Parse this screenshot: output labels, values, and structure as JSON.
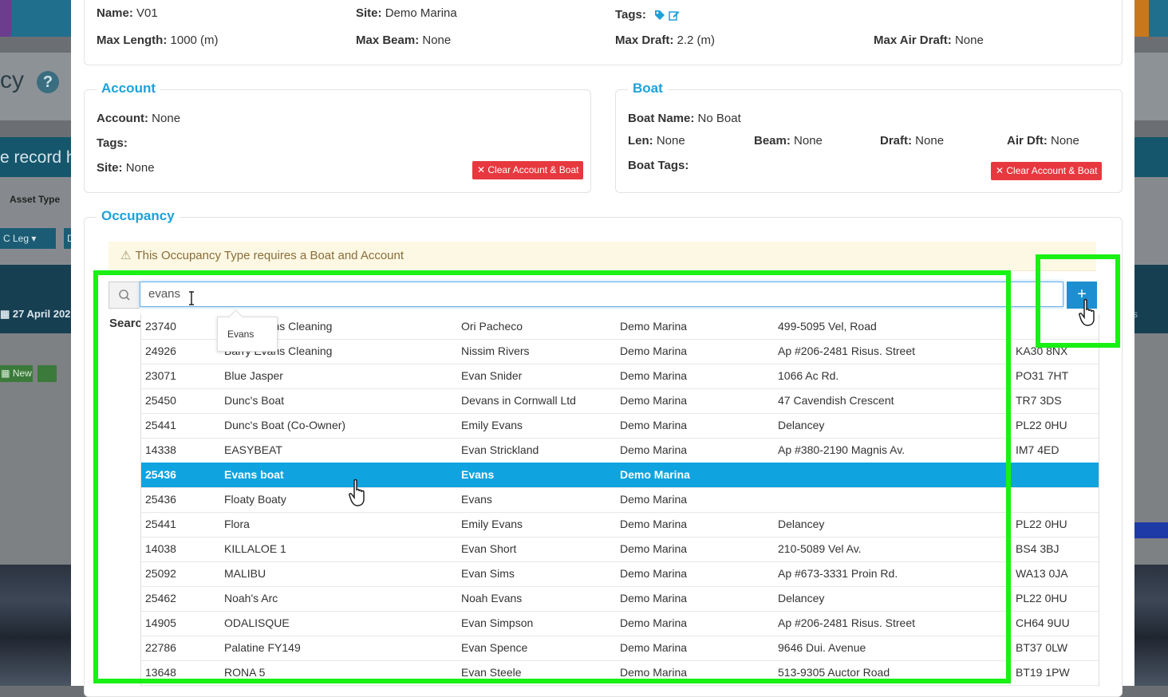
{
  "background": {
    "title_fragment": "cy",
    "help_glyph": "?",
    "record_fragment": "e record h",
    "asset_type_label": "Asset Type",
    "leg_label": "C Leg",
    "d_label": "D",
    "date_label": "27 April 202",
    "new_label": "New",
    "arrow_text": "ys"
  },
  "header": {
    "name_label": "Name:",
    "name_value": "V01",
    "site_label": "Site:",
    "site_value": "Demo Marina",
    "tags_label": "Tags:",
    "max_length_label": "Max Length:",
    "max_length_value": "1000 (m)",
    "max_beam_label": "Max Beam:",
    "max_beam_value": "None",
    "max_draft_label": "Max Draft:",
    "max_draft_value": "2.2 (m)",
    "max_air_draft_label": "Max Air Draft:",
    "max_air_draft_value": "None"
  },
  "account": {
    "legend": "Account",
    "account_label": "Account:",
    "account_value": "None",
    "tags_label": "Tags:",
    "site_label": "Site:",
    "site_value": "None",
    "clear_button": "✕ Clear Account & Boat"
  },
  "boat": {
    "legend": "Boat",
    "boat_name_label": "Boat Name:",
    "boat_name_value": "No Boat",
    "len_label": "Len:",
    "len_value": "None",
    "beam_label": "Beam:",
    "beam_value": "None",
    "draft_label": "Draft:",
    "draft_value": "None",
    "air_dft_label": "Air Dft:",
    "air_dft_value": "None",
    "boat_tags_label": "Boat Tags:",
    "clear_button": "✕ Clear Account & Boat"
  },
  "occupancy": {
    "legend": "Occupancy",
    "warning_icon": "⚠",
    "warning_text": "This Occupancy Type requires a Boat and Account",
    "search_value": "evans",
    "search_icon": "magnifier-icon",
    "plus_label": "+",
    "search_label": "Searc",
    "tooltip": "Evans"
  },
  "results": [
    {
      "id": "23740",
      "boat": "Barry Evans Cleaning",
      "owner": "Ori Pacheco",
      "site": "Demo Marina",
      "address": "499-5095 Vel, Road",
      "postcode": ""
    },
    {
      "id": "24926",
      "boat": "Barry Evans Cleaning",
      "owner": "Nissim Rivers",
      "site": "Demo Marina",
      "address": "Ap #206-2481 Risus. Street",
      "postcode": "KA30 8NX"
    },
    {
      "id": "23071",
      "boat": "Blue Jasper",
      "owner": "Evan Snider",
      "site": "Demo Marina",
      "address": "1066 Ac Rd.",
      "postcode": "PO31 7HT"
    },
    {
      "id": "25450",
      "boat": "Dunc's Boat",
      "owner": "Devans in Cornwall Ltd",
      "site": "Demo Marina",
      "address": "47 Cavendish Crescent",
      "postcode": "TR7 3DS"
    },
    {
      "id": "25441",
      "boat": "Dunc's Boat (Co-Owner)",
      "owner": "Emily Evans",
      "site": "Demo Marina",
      "address": "Delancey",
      "postcode": "PL22 0HU"
    },
    {
      "id": "14338",
      "boat": "EASYBEAT",
      "owner": "Evan Strickland",
      "site": "Demo Marina",
      "address": "Ap #380-2190 Magnis Av.",
      "postcode": "IM7 4ED"
    },
    {
      "id": "25436",
      "boat": "Evans boat",
      "owner": "Evans",
      "site": "Demo Marina",
      "address": "",
      "postcode": "",
      "selected": true
    },
    {
      "id": "25436",
      "boat": "Floaty Boaty",
      "owner": "Evans",
      "site": "Demo Marina",
      "address": "",
      "postcode": ""
    },
    {
      "id": "25441",
      "boat": "Flora",
      "owner": "Emily Evans",
      "site": "Demo Marina",
      "address": "Delancey",
      "postcode": "PL22 0HU"
    },
    {
      "id": "14038",
      "boat": "KILLALOE 1",
      "owner": "Evan Short",
      "site": "Demo Marina",
      "address": "210-5089 Vel Av.",
      "postcode": "BS4 3BJ"
    },
    {
      "id": "25092",
      "boat": "MALIBU",
      "owner": "Evan Sims",
      "site": "Demo Marina",
      "address": "Ap #673-3331 Proin Rd.",
      "postcode": "WA13 0JA"
    },
    {
      "id": "25462",
      "boat": "Noah's Arc",
      "owner": "Noah Evans",
      "site": "Demo Marina",
      "address": "Delancey",
      "postcode": "PL22 0HU"
    },
    {
      "id": "14905",
      "boat": "ODALISQUE",
      "owner": "Evan Simpson",
      "site": "Demo Marina",
      "address": "Ap #206-2481 Risus. Street",
      "postcode": "CH64 9UU"
    },
    {
      "id": "22786",
      "boat": "Palatine FY149",
      "owner": "Evan Spence",
      "site": "Demo Marina",
      "address": "9646 Dui. Avenue",
      "postcode": "BT37 0LW"
    },
    {
      "id": "13648",
      "boat": "RONA 5",
      "owner": "Evan Steele",
      "site": "Demo Marina",
      "address": "513-9305 Auctor Road",
      "postcode": "BT19 1PW"
    }
  ],
  "colors": {
    "accent": "#1fa1d8",
    "highlight": "#19f013",
    "selected_row": "#0fa3e0",
    "danger": "#e8383f"
  }
}
